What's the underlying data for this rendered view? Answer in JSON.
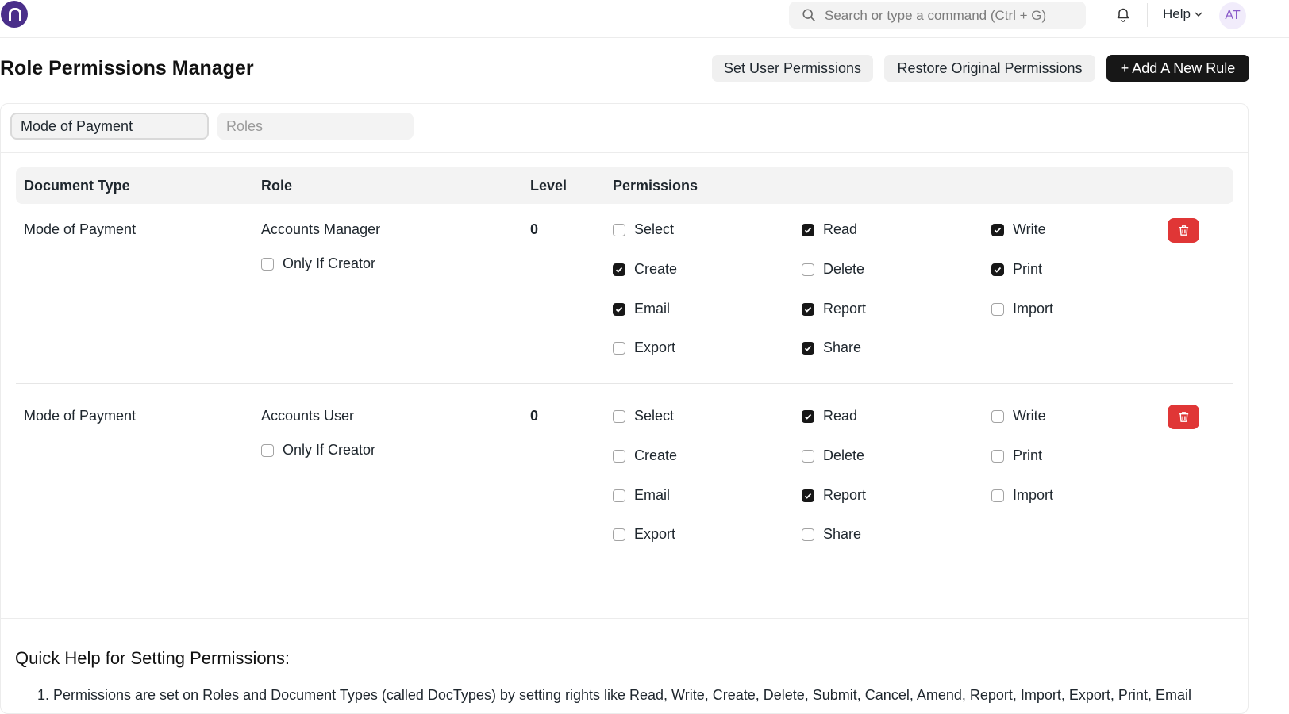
{
  "navbar": {
    "search_placeholder": "Search or type a command (Ctrl + G)",
    "help_label": "Help",
    "avatar_initials": "AT"
  },
  "page": {
    "title": "Role Permissions Manager",
    "buttons": {
      "set_user_permissions": "Set User Permissions",
      "restore_original": "Restore Original Permissions",
      "add_rule": "+ Add A New Rule"
    }
  },
  "filters": {
    "doctype_value": "Mode of Payment",
    "roles_placeholder": "Roles"
  },
  "table": {
    "headers": {
      "document_type": "Document Type",
      "role": "Role",
      "level": "Level",
      "permissions": "Permissions"
    },
    "rows": [
      {
        "document_type": "Mode of Payment",
        "role": "Accounts Manager",
        "only_if_creator_label": "Only If Creator",
        "only_if_creator": false,
        "level": "0",
        "permissions": [
          {
            "label": "Select",
            "checked": false
          },
          {
            "label": "Read",
            "checked": true
          },
          {
            "label": "Write",
            "checked": true
          },
          {
            "label": "Create",
            "checked": true
          },
          {
            "label": "Delete",
            "checked": false
          },
          {
            "label": "Print",
            "checked": true
          },
          {
            "label": "Email",
            "checked": true
          },
          {
            "label": "Report",
            "checked": true
          },
          {
            "label": "Import",
            "checked": false
          },
          {
            "label": "Export",
            "checked": false
          },
          {
            "label": "Share",
            "checked": true
          }
        ]
      },
      {
        "document_type": "Mode of Payment",
        "role": "Accounts User",
        "only_if_creator_label": "Only If Creator",
        "only_if_creator": false,
        "level": "0",
        "permissions": [
          {
            "label": "Select",
            "checked": false
          },
          {
            "label": "Read",
            "checked": true
          },
          {
            "label": "Write",
            "checked": false
          },
          {
            "label": "Create",
            "checked": false
          },
          {
            "label": "Delete",
            "checked": false
          },
          {
            "label": "Print",
            "checked": false
          },
          {
            "label": "Email",
            "checked": false
          },
          {
            "label": "Report",
            "checked": true
          },
          {
            "label": "Import",
            "checked": false
          },
          {
            "label": "Export",
            "checked": false
          },
          {
            "label": "Share",
            "checked": false
          }
        ]
      }
    ]
  },
  "quick_help": {
    "title": "Quick Help for Setting Permissions:",
    "items": [
      "1. Permissions are set on Roles and Document Types (called DocTypes) by setting rights like Read, Write, Create, Delete, Submit, Cancel, Amend, Report, Import, Export, Print, Email"
    ]
  },
  "icons": {
    "logo": "app-logo",
    "search": "search-icon",
    "bell": "bell-icon",
    "help_chevron": "chevron-down-icon",
    "delete": "trash-icon",
    "check": "check-icon"
  },
  "colors": {
    "primary_dark": "#171717",
    "danger": "#e03636",
    "logo": "#4a2f8a",
    "avatar_text": "#8a5ac9"
  }
}
